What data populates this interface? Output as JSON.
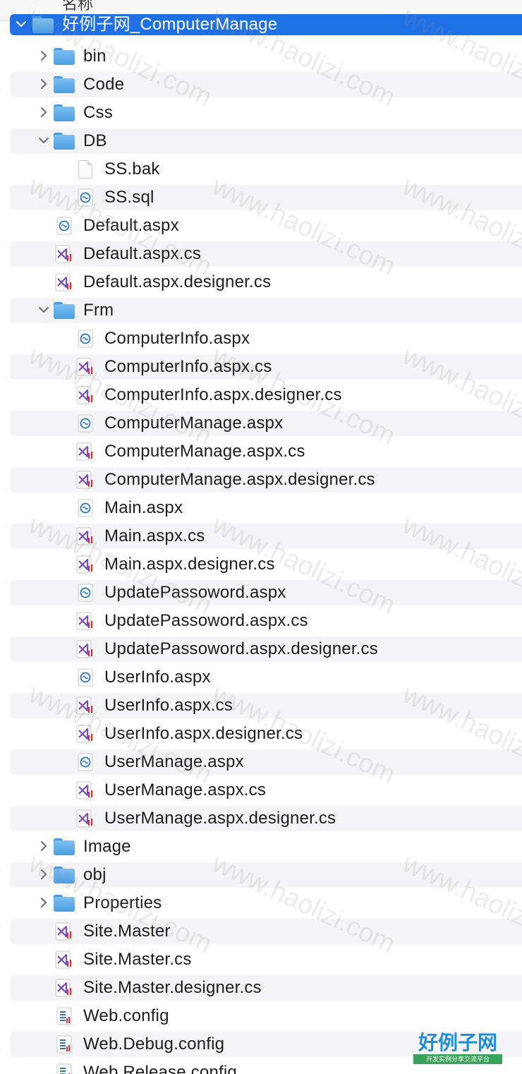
{
  "header": {
    "column_label": "名称"
  },
  "tree": [
    {
      "label": "好例子网_ComputerManage",
      "type": "folder",
      "level": 0,
      "state": "expanded",
      "selected": true
    },
    {
      "label": "bin",
      "type": "folder",
      "level": 1,
      "state": "collapsed"
    },
    {
      "label": "Code",
      "type": "folder",
      "level": 1,
      "state": "collapsed"
    },
    {
      "label": "Css",
      "type": "folder",
      "level": 1,
      "state": "collapsed"
    },
    {
      "label": "DB",
      "type": "folder",
      "level": 1,
      "state": "expanded"
    },
    {
      "label": "SS.bak",
      "type": "doc",
      "level": 2
    },
    {
      "label": "SS.sql",
      "type": "aspx",
      "level": 2
    },
    {
      "label": "Default.aspx",
      "type": "aspx",
      "level": 1
    },
    {
      "label": "Default.aspx.cs",
      "type": "cs",
      "level": 1
    },
    {
      "label": "Default.aspx.designer.cs",
      "type": "cs",
      "level": 1
    },
    {
      "label": "Frm",
      "type": "folder",
      "level": 1,
      "state": "expanded"
    },
    {
      "label": "ComputerInfo.aspx",
      "type": "aspx",
      "level": 2
    },
    {
      "label": "ComputerInfo.aspx.cs",
      "type": "cs",
      "level": 2
    },
    {
      "label": "ComputerInfo.aspx.designer.cs",
      "type": "cs",
      "level": 2
    },
    {
      "label": "ComputerManage.aspx",
      "type": "aspx",
      "level": 2
    },
    {
      "label": "ComputerManage.aspx.cs",
      "type": "cs",
      "level": 2
    },
    {
      "label": "ComputerManage.aspx.designer.cs",
      "type": "cs",
      "level": 2
    },
    {
      "label": "Main.aspx",
      "type": "aspx",
      "level": 2
    },
    {
      "label": "Main.aspx.cs",
      "type": "cs",
      "level": 2
    },
    {
      "label": "Main.aspx.designer.cs",
      "type": "cs",
      "level": 2
    },
    {
      "label": "UpdatePassoword.aspx",
      "type": "aspx",
      "level": 2
    },
    {
      "label": "UpdatePassoword.aspx.cs",
      "type": "cs",
      "level": 2
    },
    {
      "label": "UpdatePassoword.aspx.designer.cs",
      "type": "cs",
      "level": 2
    },
    {
      "label": "UserInfo.aspx",
      "type": "aspx",
      "level": 2
    },
    {
      "label": "UserInfo.aspx.cs",
      "type": "cs",
      "level": 2
    },
    {
      "label": "UserInfo.aspx.designer.cs",
      "type": "cs",
      "level": 2
    },
    {
      "label": "UserManage.aspx",
      "type": "aspx",
      "level": 2
    },
    {
      "label": "UserManage.aspx.cs",
      "type": "cs",
      "level": 2
    },
    {
      "label": "UserManage.aspx.designer.cs",
      "type": "cs",
      "level": 2
    },
    {
      "label": "Image",
      "type": "folder",
      "level": 1,
      "state": "collapsed"
    },
    {
      "label": "obj",
      "type": "folder",
      "level": 1,
      "state": "collapsed"
    },
    {
      "label": "Properties",
      "type": "folder",
      "level": 1,
      "state": "collapsed"
    },
    {
      "label": "Site.Master",
      "type": "cs",
      "level": 1
    },
    {
      "label": "Site.Master.cs",
      "type": "cs",
      "level": 1
    },
    {
      "label": "Site.Master.designer.cs",
      "type": "cs",
      "level": 1
    },
    {
      "label": "Web.config",
      "type": "config",
      "level": 1
    },
    {
      "label": "Web.Debug.config",
      "type": "config",
      "level": 1
    },
    {
      "label": "Web.Release.config",
      "type": "config",
      "level": 1
    }
  ],
  "watermark": {
    "text": "www.haolizi.com"
  },
  "logo": {
    "main": "好例子网",
    "sub": "开发实例分享交流平台"
  },
  "colors": {
    "selection": "#1f6fe5",
    "folder": "#5aaaf0",
    "vs_purple": "#7a4fbf",
    "vs_red": "#d9332b",
    "aspx_blue": "#3b82c4"
  }
}
